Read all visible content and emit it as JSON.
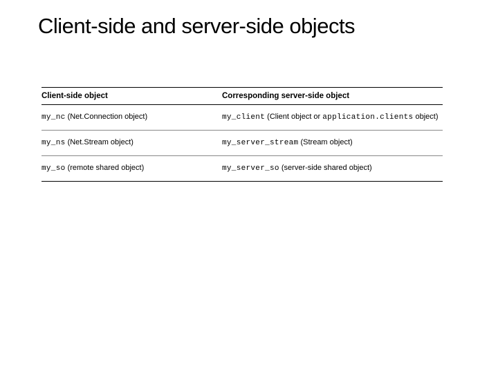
{
  "title": "Client-side and server-side objects",
  "table": {
    "headers": {
      "left": "Client-side object",
      "right": "Corresponding server-side object"
    },
    "rows": [
      {
        "client_code": "my_nc",
        "client_desc": " (Net.Connection object)",
        "server_code": "my_client",
        "server_desc": " (Client object or ",
        "server_code2": "application.clients",
        "server_desc2": " object)"
      },
      {
        "client_code": "my_ns",
        "client_desc": " (Net.Stream object)",
        "server_code": "my_server_stream",
        "server_desc": " (Stream object)",
        "server_code2": "",
        "server_desc2": ""
      },
      {
        "client_code": "my_so",
        "client_desc": " (remote shared object)",
        "server_code": "my_server_so",
        "server_desc": " (server-side shared object)",
        "server_code2": "",
        "server_desc2": ""
      }
    ]
  }
}
